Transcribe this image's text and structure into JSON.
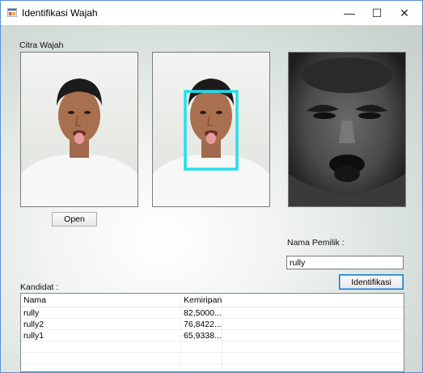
{
  "window": {
    "title": "Identifikasi Wajah",
    "minimize": "—",
    "maximize": "☐",
    "close": "✕"
  },
  "labels": {
    "citra_wajah": "Citra Wajah",
    "nama_pemilik": "Nama Pemilik :",
    "kandidat": "Kandidat :"
  },
  "buttons": {
    "open": "Open",
    "identifikasi": "Identifikasi"
  },
  "nama_pemilik_value": "rully",
  "candidates": {
    "columns": [
      "Nama",
      "Kemiripan"
    ],
    "rows": [
      {
        "nama": "rully",
        "kemiripan": "82,5000..."
      },
      {
        "nama": "rully2",
        "kemiripan": "76,8422..."
      },
      {
        "nama": "rully1",
        "kemiripan": "65,9338..."
      }
    ]
  },
  "colors": {
    "detection_box": "#22e0ee",
    "window_border": "#5a8fcf",
    "focus": "#0078d7"
  }
}
